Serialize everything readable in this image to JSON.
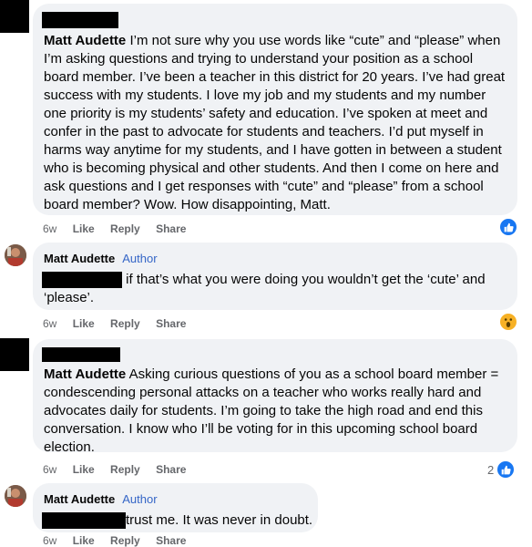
{
  "comments": [
    {
      "author": "Matt Audette",
      "text": "I’m not sure why you use words like “cute” and “please” when I’m asking questions and trying to understand your position as a school board member. I’ve been a teacher in this district for 20 years. I’ve had great success with my students. I love my job and my students and my number one priority is my students’ safety and education. I’ve spoken at meet and confer in the past to advocate for students and teachers. I’d put myself in harms way anytime for my students, and I have gotten in between a student who is becoming physical and other students. And then I come on here and ask questions and I get responses with “cute” and “please” from a school board member? Wow. How disappointing, Matt.",
      "age": "6w",
      "like": "Like",
      "reply": "Reply",
      "share": "Share",
      "reaction": "like-icon",
      "reaction_count": ""
    },
    {
      "author": "Matt Audette",
      "badge": "Author",
      "text": " if that’s what you were doing you wouldn’t get the ‘cute’ and ‘please’.",
      "age": "6w",
      "like": "Like",
      "reply": "Reply",
      "share": "Share",
      "reaction": "wow-icon",
      "reaction_count": ""
    },
    {
      "author": "Matt Audette",
      "text": "Asking curious questions of you as a school board member = condescending personal attacks on a teacher who works really hard and advocates daily for students. I’m going to take the high road and end this conversation. I know who I’ll be voting for in this upcoming school board election.",
      "age": "6w",
      "like": "Like",
      "reply": "Reply",
      "share": "Share",
      "reaction": "like-icon",
      "reaction_count": "2"
    },
    {
      "author": "Matt Audette",
      "badge": "Author",
      "text": "trust me. It was never in doubt.",
      "age": "6w",
      "like": "Like",
      "reply": "Reply",
      "share": "Share"
    }
  ],
  "colors": {
    "bubble": "#f0f2f5",
    "author_badge": "#3566c7",
    "like": "#1877f2",
    "wow": "#f7b125"
  }
}
